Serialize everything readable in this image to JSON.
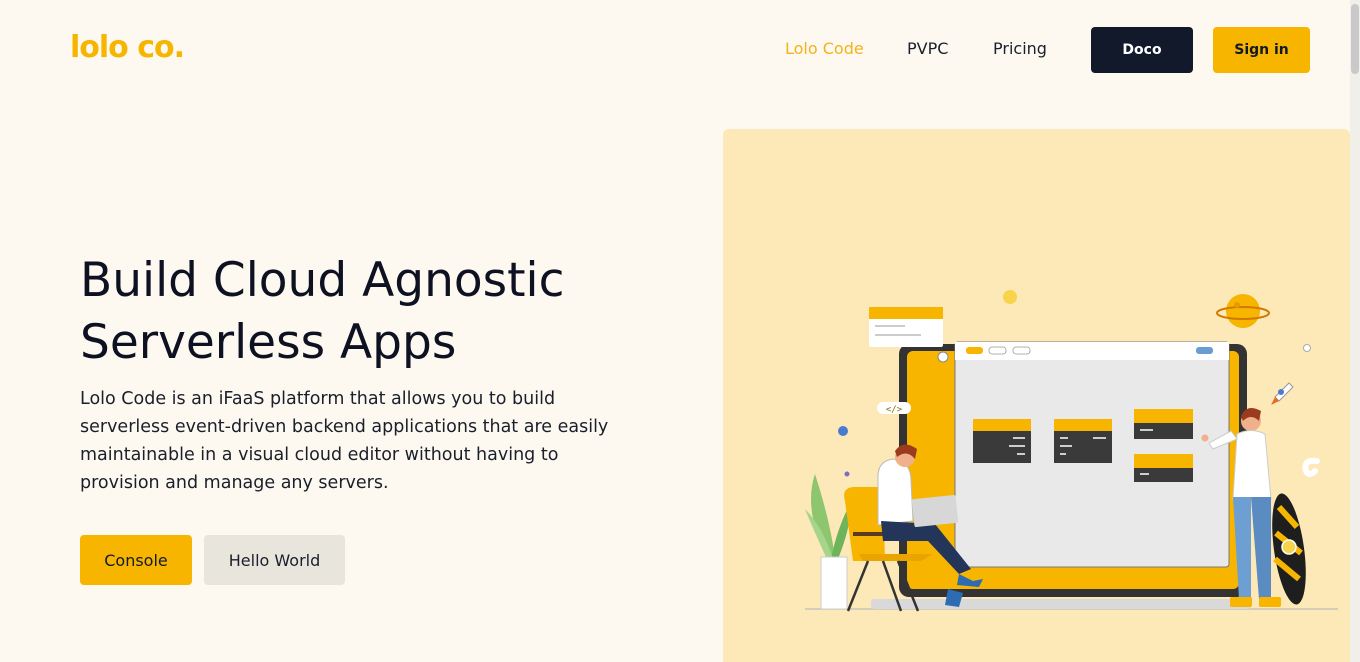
{
  "header": {
    "logo_text": "lolo co.",
    "nav": {
      "lolo_code": "Lolo Code",
      "pvpc": "PVPC",
      "pricing": "Pricing"
    },
    "doco_label": "Doco",
    "signin_label": "Sign in"
  },
  "hero": {
    "title_line1": "Build Cloud Agnostic",
    "title_line2": "Serverless Apps",
    "description": "Lolo Code is an iFaaS platform that allows you to build serverless event-driven backend applications that are easily maintainable in a visual cloud editor without having to provision and manage any servers.",
    "console_label": "Console",
    "hello_world_label": "Hello World"
  },
  "illustration": {
    "code_tag": "</>"
  },
  "colors": {
    "accent": "#f7b500",
    "dark": "#12192b",
    "background": "#fdf9f0",
    "panel": "#fde9b8"
  }
}
